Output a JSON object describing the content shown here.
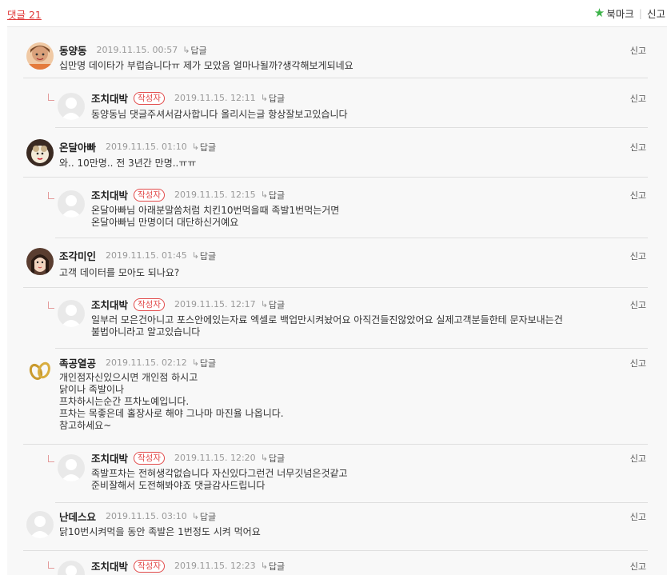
{
  "header": {
    "comment_count_label": "댓글 21",
    "bookmark_label": "북마크",
    "report_label": "신고"
  },
  "ui": {
    "reply_label": "답글",
    "report_label": "신고",
    "author_badge": "작성자"
  },
  "comments": [
    {
      "nick": "동양동",
      "date": "2019.11.15. 00:57",
      "lines": [
        "십만명 데이타가 부럽습니다ㅠ 제가 모았음 얼마나될까?생각해보게되네요"
      ]
    },
    {
      "nick": "조치대박",
      "date": "2019.11.15. 12:11",
      "lines": [
        "동양동님 댓글주셔서감사합니다 올리시는글 항상잘보고있습니다"
      ]
    },
    {
      "nick": "온달아빠",
      "date": "2019.11.15. 01:10",
      "lines": [
        "와.. 10만명.. 전 3년간 만명..ㅠㅠ"
      ]
    },
    {
      "nick": "조치대박",
      "date": "2019.11.15. 12:15",
      "lines": [
        "온달아빠님 아래분말씀처럼 치킨10번먹을때 족발1번먹는거면",
        "온달아빠님 만명이더 대단하신거예요"
      ]
    },
    {
      "nick": "조각미인",
      "date": "2019.11.15. 01:45",
      "lines": [
        "고객 데이터를 모아도 되나요?"
      ]
    },
    {
      "nick": "조치대박",
      "date": "2019.11.15. 12:17",
      "lines": [
        "일부러 모은건아니고 포스안에있는자료 엑셀로 백업만시켜놨어요 아직건들진않았어요 실제고객분들한테 문자보내는건",
        "불법아니라고 알고있습니다"
      ]
    },
    {
      "nick": "족공열공",
      "date": "2019.11.15. 02:12",
      "lines": [
        "개인점자신있으시면 개인점 하시고",
        "닭이나 족발이나",
        "프차하시는순간 프차노예입니다.",
        "프차는 목좋은데 홀장사로 해야 그나마 마진율 나옵니다.",
        "참고하세요~"
      ]
    },
    {
      "nick": "조치대박",
      "date": "2019.11.15. 12:20",
      "lines": [
        "족발프차는 전혀생각없습니다 자신있다그런건 너무깃넘은것같고",
        "준비잘해서 도전해봐야죠 댓글감사드립니다"
      ]
    },
    {
      "nick": "난데스요",
      "date": "2019.11.15. 03:10",
      "lines": [
        "닭10번시켜먹을 동안 족발은 1번정도 시켜 먹어요"
      ]
    },
    {
      "nick": "조치대박",
      "date": "2019.11.15. 12:23",
      "lines": []
    }
  ]
}
